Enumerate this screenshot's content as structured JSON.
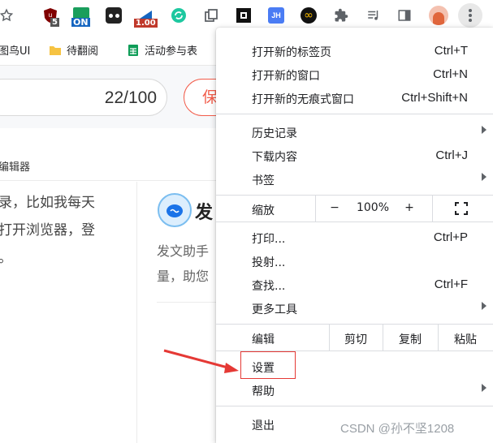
{
  "toolbar": {
    "ext_badge_5": "5",
    "ext_badge_on": "ON",
    "ext_badge_zoom": "1.00",
    "ext_jh": "JH",
    "colors": {
      "ublock": "#800000",
      "on_green": "#1a9e5c",
      "zoom_red": "#c0392b",
      "jh_blue": "#4a7cf4",
      "refresh_green": "#1ec8a0"
    }
  },
  "bookmarks": [
    {
      "label": "图鸟UI"
    },
    {
      "label": "待翻阅"
    },
    {
      "label": "活动参与表"
    }
  ],
  "page": {
    "counter": "22/100",
    "publish_partial": "保",
    "editor_label": "编辑器",
    "left_text": [
      "录，比如我每天",
      "打开浏览器，登",
      "。"
    ],
    "fa_title": "发",
    "fa_desc": [
      "发文助手",
      "量，助您"
    ]
  },
  "menu": {
    "items": [
      {
        "label": "打开新的标签页",
        "shortcut": "Ctrl+T"
      },
      {
        "label": "打开新的窗口",
        "shortcut": "Ctrl+N"
      },
      {
        "label": "打开新的无痕式窗口",
        "shortcut": "Ctrl+Shift+N"
      },
      {
        "label": "历史记录",
        "shortcut": ""
      },
      {
        "label": "下载内容",
        "shortcut": "Ctrl+J"
      },
      {
        "label": "书签",
        "shortcut": ""
      },
      {
        "label": "打印...",
        "shortcut": "Ctrl+P"
      },
      {
        "label": "投射...",
        "shortcut": ""
      },
      {
        "label": "查找...",
        "shortcut": "Ctrl+F"
      },
      {
        "label": "更多工具",
        "shortcut": ""
      },
      {
        "label": "设置",
        "shortcut": ""
      },
      {
        "label": "帮助",
        "shortcut": ""
      },
      {
        "label": "退出",
        "shortcut": ""
      }
    ],
    "zoom": {
      "label": "缩放",
      "minus": "−",
      "value": "100%",
      "plus": "+"
    },
    "edit": {
      "label": "编辑",
      "cut": "剪切",
      "copy": "复制",
      "paste": "粘贴"
    }
  },
  "watermark": "CSDN @孙不坚1208"
}
